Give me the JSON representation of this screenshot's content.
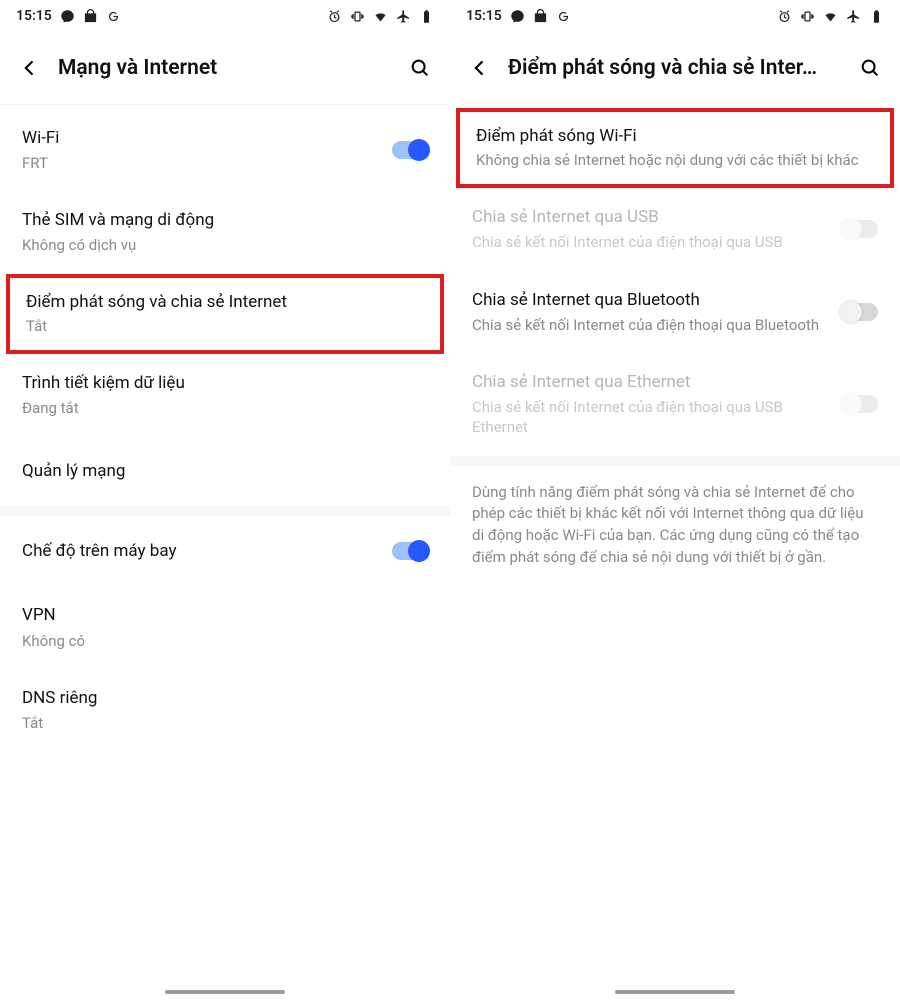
{
  "status": {
    "time": "15:15",
    "icons_left": [
      "messenger",
      "bag",
      "g"
    ],
    "icons_right": [
      "alarm",
      "vibrate",
      "wifi",
      "airplane",
      "battery"
    ]
  },
  "left": {
    "title": "Mạng và Internet",
    "wifi": {
      "title": "Wi-Fi",
      "sub": "FRT",
      "toggle": "on"
    },
    "sim": {
      "title": "Thẻ SIM và mạng di động",
      "sub": "Không có dịch vụ"
    },
    "hotspot": {
      "title": "Điểm phát sóng và chia sẻ Internet",
      "sub": "Tắt"
    },
    "datasaver": {
      "title": "Trình tiết kiệm dữ liệu",
      "sub": "Đang tắt"
    },
    "netmgmt": {
      "title": "Quản lý mạng"
    },
    "airplane": {
      "title": "Chế độ trên máy bay",
      "toggle": "on"
    },
    "vpn": {
      "title": "VPN",
      "sub": "Không có"
    },
    "dns": {
      "title": "DNS riêng",
      "sub": "Tắt"
    }
  },
  "right": {
    "title": "Điểm phát sóng và chia sẻ Inter…",
    "wifihs": {
      "title": "Điểm phát sóng Wi-Fi",
      "sub": "Không chia sẻ Internet hoặc nội dung với các thiết bị khác"
    },
    "usb": {
      "title": "Chia sẻ Internet qua USB",
      "sub": "Chia sẻ kết nối Internet của điện thoại qua USB",
      "toggle": "off",
      "disabled": true
    },
    "bt": {
      "title": "Chia sẻ Internet qua Bluetooth",
      "sub": "Chia sẻ kết nối Internet của điện thoại qua Bluetooth",
      "toggle": "off",
      "disabled": false
    },
    "eth": {
      "title": "Chia sẻ Internet qua Ethernet",
      "sub": "Chia sẻ kết nối Internet của điện thoại qua USB Ethernet",
      "toggle": "off",
      "disabled": true
    },
    "help": "Dùng tính năng điểm phát sóng và chia sẻ Internet để cho phép các thiết bị khác kết nối với Internet thông qua dữ liệu di động hoặc Wi-Fi của bạn. Các ứng dụng cũng có thể tạo điểm phát sóng để chia sẻ nội dung với thiết bị ở gần."
  }
}
